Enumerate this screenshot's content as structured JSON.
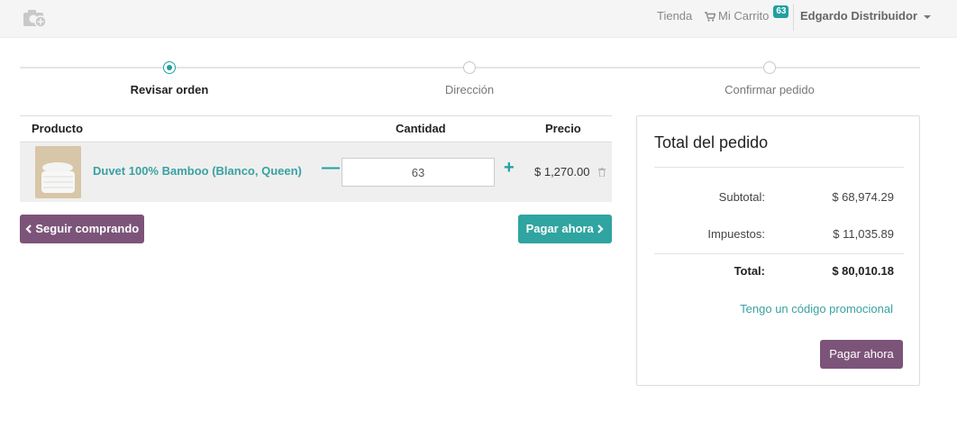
{
  "navbar": {
    "shop_label": "Tienda",
    "cart_label": "Mi Carrito",
    "cart_count": "63",
    "user_label": "Edgardo Distribuidor"
  },
  "wizard": {
    "steps": [
      {
        "label": "Revisar orden",
        "active": true
      },
      {
        "label": "Dirección",
        "active": false
      },
      {
        "label": "Confirmar pedido",
        "active": false
      }
    ]
  },
  "cart": {
    "headers": {
      "product": "Producto",
      "quantity": "Cantidad",
      "price": "Precio"
    },
    "items": [
      {
        "name": "Duvet 100% Bamboo (Blanco, Queen)",
        "quantity": "63",
        "price": "$ 1,270.00"
      }
    ],
    "continue_label": "Seguir comprando",
    "pay_label": "Pagar ahora"
  },
  "summary": {
    "title": "Total del pedido",
    "subtotal_label": "Subtotal:",
    "subtotal_value": "$ 68,974.29",
    "taxes_label": "Impuestos:",
    "taxes_value": "$ 11,035.89",
    "total_label": "Total:",
    "total_value": "$ 80,010.18",
    "promo_label": "Tengo un código promocional",
    "pay_label": "Pagar ahora"
  },
  "colors": {
    "accent": "#21a0a0",
    "primary": "#7c5479"
  }
}
